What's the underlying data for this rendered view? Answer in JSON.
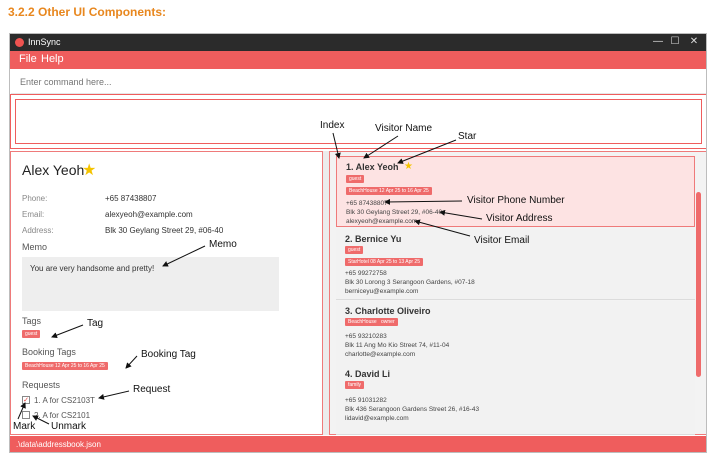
{
  "doc": {
    "heading": "3.2.2 Other UI Components:"
  },
  "window": {
    "title": "InnSync",
    "controls": {
      "minimize": "—",
      "maximize": "☐",
      "close": "✕"
    },
    "menu": [
      "File",
      "Help"
    ],
    "command_placeholder": "Enter command here...",
    "status_path": ".\\data\\addressbook.json"
  },
  "detail": {
    "name": "Alex Yeoh",
    "star": "★",
    "fields": [
      {
        "label": "Phone:",
        "value": "+65 87438807"
      },
      {
        "label": "Email:",
        "value": "alexyeoh@example.com"
      },
      {
        "label": "Address:",
        "value": "Blk 30 Geylang Street 29, #06-40"
      }
    ],
    "memo_title": "Memo",
    "memo_text": "You are very handsome and pretty!",
    "tags_title": "Tags",
    "tags": [
      "guest"
    ],
    "booking_tags_title": "Booking Tags",
    "booking_tags": [
      "BeachHouse 12 Apr 25 to 16 Apr 25"
    ],
    "requests_title": "Requests",
    "requests": [
      {
        "text": "1. A for CS2103T",
        "checked": true,
        "mark": "✓"
      },
      {
        "text": "2. A for CS2101",
        "checked": false,
        "mark": ""
      }
    ]
  },
  "list": [
    {
      "title": "1.  Alex Yeoh",
      "star": "★",
      "tags": [
        "guest"
      ],
      "booking": "BeachHouse 12 Apr 25 to 16 Apr 25",
      "phone": "+65 87438807",
      "address": "Blk 30 Geylang Street 29, #06-40",
      "email": "alexyeoh@example.com"
    },
    {
      "title": "2.  Bernice Yu",
      "star": "",
      "tags": [
        "guest"
      ],
      "booking": "StarHotel 08 Apr 25 to 13 Apr 25",
      "phone": "+65 99272758",
      "address": "Blk 30 Lorong 3 Serangoon Gardens, #07-18",
      "email": "berniceyu@example.com"
    },
    {
      "title": "3.  Charlotte Oliveiro",
      "star": "",
      "tags": [
        "BeachHouse",
        "owner"
      ],
      "booking": "",
      "phone": "+65 93210283",
      "address": "Blk 11 Ang Mo Kio Street 74, #11-04",
      "email": "charlotte@example.com"
    },
    {
      "title": "4.  David Li",
      "star": "",
      "tags": [
        "family"
      ],
      "booking": "",
      "phone": "+65 91031282",
      "address": "Blk 436 Serangoon Gardens Street 26, #16-43",
      "email": "lidavid@example.com"
    }
  ],
  "annotations": {
    "index": "Index",
    "visitor_name": "Visitor Name",
    "star": "Star",
    "visitor_phone": "Visitor Phone Number",
    "visitor_address": "Visitor Address",
    "visitor_email": "Visitor Email",
    "memo": "Memo",
    "tag": "Tag",
    "booking_tag": "Booking Tag",
    "request": "Request",
    "mark": "Mark",
    "unmark": "Unmark"
  },
  "colors": {
    "accent": "#ef5d5d",
    "tag": "#ef6b6b",
    "star": "#f5c400",
    "heading": "#e8871e"
  }
}
